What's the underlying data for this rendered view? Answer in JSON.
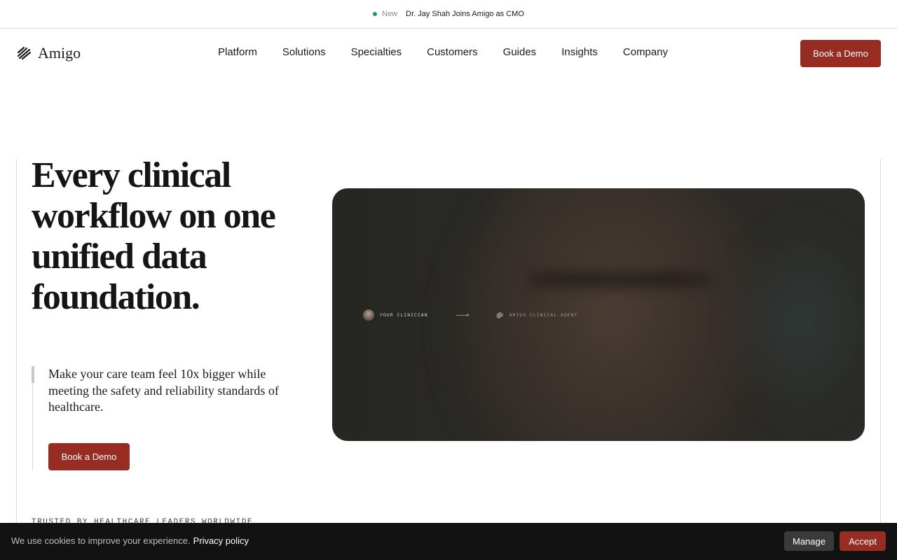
{
  "announcement": {
    "tag": "New",
    "headline": "Dr. Jay Shah Joins Amigo as CMO"
  },
  "nav": {
    "brand": "Amigo",
    "items": [
      {
        "label": "Platform"
      },
      {
        "label": "Solutions"
      },
      {
        "label": "Specialties"
      },
      {
        "label": "Customers"
      },
      {
        "label": "Guides"
      },
      {
        "label": "Insights"
      },
      {
        "label": "Company"
      }
    ],
    "cta": "Book a Demo"
  },
  "hero": {
    "title": "Every clinical workflow on one unified data foundation.",
    "subtitle": "Make your care team feel 10x bigger while meeting the safety and reliability standards of healthcare.",
    "cta": "Book a Demo"
  },
  "media": {
    "clinician_label": "YOUR CLINICIAN",
    "agent_label": "AMIGO CLINICAL AGENT"
  },
  "trusted": {
    "label": "TRUSTED BY HEALTHCARE LEADERS WORLDWIDE"
  },
  "cookie": {
    "message": "We use cookies to improve your experience.",
    "policy_link": "Privacy policy",
    "manage": "Manage",
    "accept": "Accept"
  },
  "colors": {
    "brand": "#962c22",
    "status_dot": "#22a04b",
    "cookie_bar": "#121212"
  }
}
